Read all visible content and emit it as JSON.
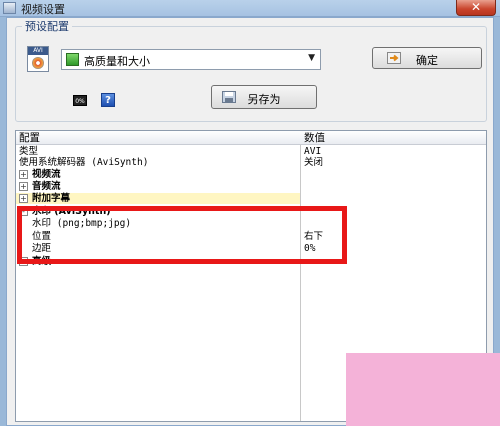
{
  "window": {
    "title": "视频设置",
    "close_glyph": "✕"
  },
  "preset": {
    "group_title": "预设配置",
    "selected": "高质量和大小",
    "confirm_label": "确定",
    "save_as_label": "另存为",
    "avi_badge": "AVI",
    "small_icon_text": "0%",
    "help_icon_text": "?"
  },
  "grid": {
    "col_config": "配置",
    "col_value": "数值",
    "rows": [
      {
        "label": "类型",
        "value": "AVI"
      },
      {
        "label": "使用系统解码器 (AviSynth)",
        "value": "关闭"
      },
      {
        "label": "视频流",
        "value": "",
        "expander": "+"
      },
      {
        "label": "音频流",
        "value": "",
        "expander": "+"
      },
      {
        "label": "附加字幕",
        "value": "",
        "expander": "+"
      },
      {
        "label": "水印 (AviSynth)",
        "value": "",
        "expander": "-"
      },
      {
        "label": "水印 (png;bmp;jpg)",
        "value": ""
      },
      {
        "label": "位置",
        "value": "右下"
      },
      {
        "label": "边距",
        "value": "0%"
      },
      {
        "label": "高级",
        "value": "",
        "expander": "+"
      }
    ]
  },
  "colors": {
    "highlight_border": "#e81818",
    "selected_row": "#fff6c2",
    "corner_pink": "#f4b2d8"
  }
}
